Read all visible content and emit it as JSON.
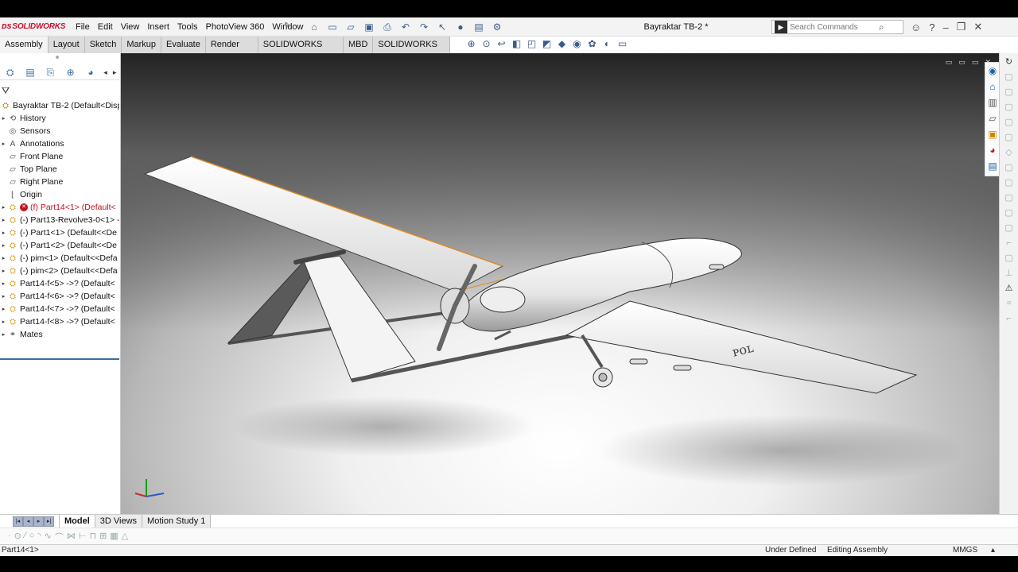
{
  "app": {
    "logo": "SOLIDWORKS",
    "document_title": "Bayraktar TB-2 *"
  },
  "menu": [
    "File",
    "Edit",
    "View",
    "Insert",
    "Tools",
    "PhotoView 360",
    "Window"
  ],
  "search": {
    "placeholder": "Search Commands"
  },
  "command_tabs": [
    "Assembly",
    "Layout",
    "Sketch",
    "Markup",
    "Evaluate",
    "Render Tools",
    "SOLIDWORKS Add-Ins",
    "MBD",
    "SOLIDWORKS CAM"
  ],
  "tree": {
    "root": "Bayraktar TB-2  (Default<Displ",
    "items": [
      {
        "label": "History",
        "icon": "history-icon",
        "expand": true
      },
      {
        "label": "Sensors",
        "icon": "sensors-icon",
        "expand": false
      },
      {
        "label": "Annotations",
        "icon": "annotations-icon",
        "expand": true
      },
      {
        "label": "Front Plane",
        "icon": "plane-icon",
        "expand": false
      },
      {
        "label": "Top Plane",
        "icon": "plane-icon",
        "expand": false
      },
      {
        "label": "Right Plane",
        "icon": "plane-icon",
        "expand": false
      },
      {
        "label": "Origin",
        "icon": "origin-icon",
        "expand": false
      },
      {
        "label": "(f) Part14<1> (Default<",
        "icon": "part-icon",
        "expand": true,
        "error": true
      },
      {
        "label": "(-) Part13-Revolve3-0<1> -",
        "icon": "part-icon",
        "expand": true
      },
      {
        "label": "(-) Part1<1> (Default<<De",
        "icon": "part-icon",
        "expand": true
      },
      {
        "label": "(-) Part1<2> (Default<<De",
        "icon": "part-icon",
        "expand": true
      },
      {
        "label": "(-) pim<1> (Default<<Defa",
        "icon": "part-icon",
        "expand": true
      },
      {
        "label": "(-) pim<2> (Default<<Defa",
        "icon": "part-icon",
        "expand": true
      },
      {
        "label": "Part14-f<5> ->? (Default<",
        "icon": "part-icon",
        "expand": true
      },
      {
        "label": "Part14-f<6> ->? (Default<",
        "icon": "part-icon",
        "expand": true
      },
      {
        "label": "Part14-f<7> ->? (Default<",
        "icon": "part-icon",
        "expand": true
      },
      {
        "label": "Part14-f<8> ->? (Default<",
        "icon": "part-icon",
        "expand": true
      },
      {
        "label": "Mates",
        "icon": "mates-icon",
        "expand": true
      }
    ]
  },
  "bottom_tabs": [
    "Model",
    "3D Views",
    "Motion Study 1"
  ],
  "status": {
    "left": "Part14<1>",
    "state": "Under Defined",
    "mode": "Editing Assembly",
    "units": "MMGS"
  },
  "colors": {
    "accent": "#3a6d9e",
    "error": "#c0121b",
    "edge_highlight": "#e08a1e"
  }
}
